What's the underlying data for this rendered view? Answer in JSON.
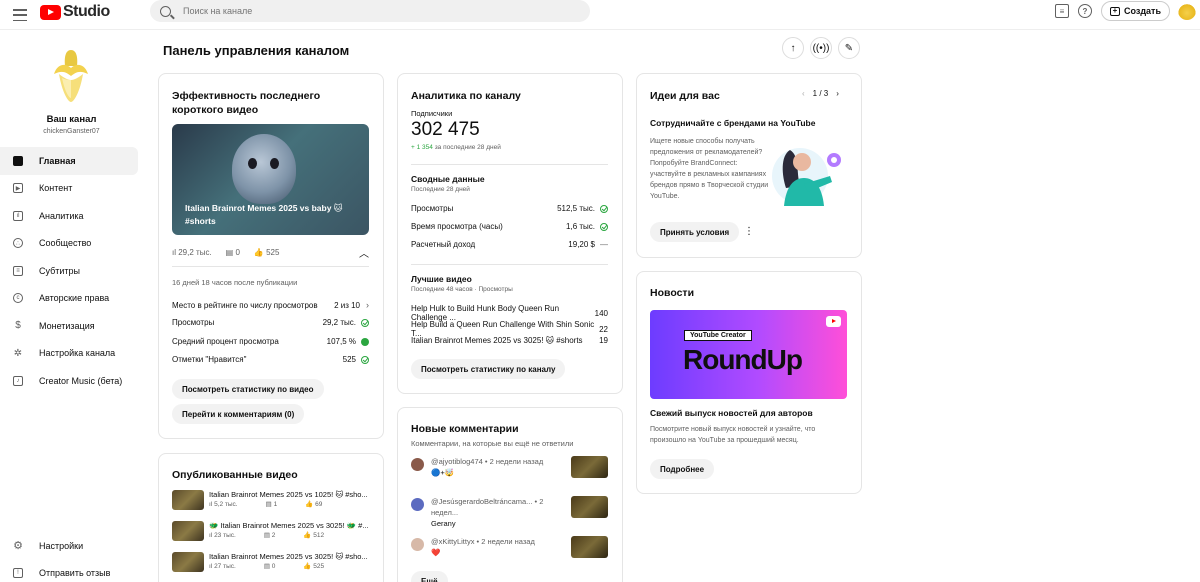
{
  "header": {
    "logo_text": "Studio",
    "search_placeholder": "Поиск на канале",
    "create_label": "Создать"
  },
  "sidebar": {
    "channel_label": "Ваш канал",
    "channel_handle": "chickenGanster07",
    "items": [
      {
        "label": "Главная",
        "icon": "dashboard-icon"
      },
      {
        "label": "Контент",
        "icon": "content-icon"
      },
      {
        "label": "Аналитика",
        "icon": "analytics-icon"
      },
      {
        "label": "Сообщество",
        "icon": "community-icon"
      },
      {
        "label": "Субтитры",
        "icon": "subtitles-icon"
      },
      {
        "label": "Авторские права",
        "icon": "copyright-icon"
      },
      {
        "label": "Монетизация",
        "icon": "dollar-icon"
      },
      {
        "label": "Настройка канала",
        "icon": "wand-icon"
      },
      {
        "label": "Creator Music (бета)",
        "icon": "music-icon"
      }
    ],
    "bottom_items": [
      {
        "label": "Настройки",
        "icon": "gear-icon"
      },
      {
        "label": "Отправить отзыв",
        "icon": "feedback-icon"
      }
    ]
  },
  "page_title": "Панель управления каналом",
  "latest_short": {
    "title": "Эффективность последнего короткого видео",
    "video_title": "Italian Brainrot Memes 2025 vs baby 🐱 #shorts",
    "views": "29,2 тыс.",
    "comments": "0",
    "likes": "525",
    "since": "16 дней 18 часов после публикации",
    "rows": [
      {
        "label": "Место в рейтинге по числу просмотров",
        "value": "2 из 10"
      },
      {
        "label": "Просмотры",
        "value": "29,2 тыс."
      },
      {
        "label": "Средний процент просмотра",
        "value": "107,5 %"
      },
      {
        "label": "Отметки \"Нравится\"",
        "value": "525"
      }
    ],
    "btn_stats": "Посмотреть статистику по видео",
    "btn_comments": "Перейти к комментариям (0)"
  },
  "published": {
    "title": "Опубликованные видео",
    "videos": [
      {
        "title": "Italian Brainrot Memes 2025 vs 1025! 🐱 #sho...",
        "views": "5,2 тыс.",
        "comments": "1",
        "likes": "69"
      },
      {
        "title": "🐲 Italian Brainrot Memes 2025 vs 3025! 🐲 #...",
        "views": "23 тыс.",
        "comments": "2",
        "likes": "512"
      },
      {
        "title": "Italian Brainrot Memes 2025 vs 3025! 🐱 #sho...",
        "views": "27 тыс.",
        "comments": "0",
        "likes": "525"
      }
    ]
  },
  "analytics": {
    "title": "Аналитика по каналу",
    "subs_label": "Подписчики",
    "subs_value": "302 475",
    "subs_delta": "+ 1 354",
    "subs_delta_suffix": "за последние 28 дней",
    "summary_title": "Сводные данные",
    "summary_period": "Последние 28 дней",
    "summary_rows": [
      {
        "label": "Просмотры",
        "value": "512,5 тыс."
      },
      {
        "label": "Время просмотра (часы)",
        "value": "1,6 тыс."
      },
      {
        "label": "Расчетный доход",
        "value": "19,20 $"
      }
    ],
    "top_title": "Лучшие видео",
    "top_period": "Последние 48 часов · Просмотры",
    "top_rows": [
      {
        "label": "Help Hulk to Build Hunk Body Queen Run Challenge ...",
        "value": "140"
      },
      {
        "label": "Help Build a Queen Run Challenge With Shin Sonic T...",
        "value": "22"
      },
      {
        "label": "Italian Brainrot Memes 2025 vs 3025! 🐱 #shorts",
        "value": "19"
      }
    ],
    "btn": "Посмотреть статистику по каналу"
  },
  "comments": {
    "title": "Новые комментарии",
    "subtitle": "Комментарии, на которые вы ещё не ответили",
    "items": [
      {
        "author": "@ajyotiblog474",
        "time": "2 недели назад",
        "text": "🔵+🤯"
      },
      {
        "author": "@JesúsgerardoBeltráncama...",
        "time": "2 недел...",
        "text": "Gerany"
      },
      {
        "author": "@xKittyLittyx",
        "time": "2 недели назад",
        "text": "❤️"
      }
    ],
    "more_btn": "Ещё"
  },
  "ideas": {
    "title": "Идеи для вас",
    "pager": "1 / 3",
    "subtitle": "Сотрудничайте с брендами на YouTube",
    "body": "Ищете новые способы получать предложения от рекламодателей? Попробуйте BrandConnect: участвуйте в рекламных кампаниях брендов прямо в Творческой студии YouTube.",
    "btn": "Принять условия"
  },
  "news": {
    "title": "Новости",
    "banner_small": "YouTube Creator",
    "banner_big": "RoundUp",
    "subtitle": "Свежий выпуск новостей для авторов",
    "body": "Посмотрите новый выпуск новостей и узнайте, что произошло на YouTube за прошедший месяц.",
    "btn": "Подробнее"
  }
}
